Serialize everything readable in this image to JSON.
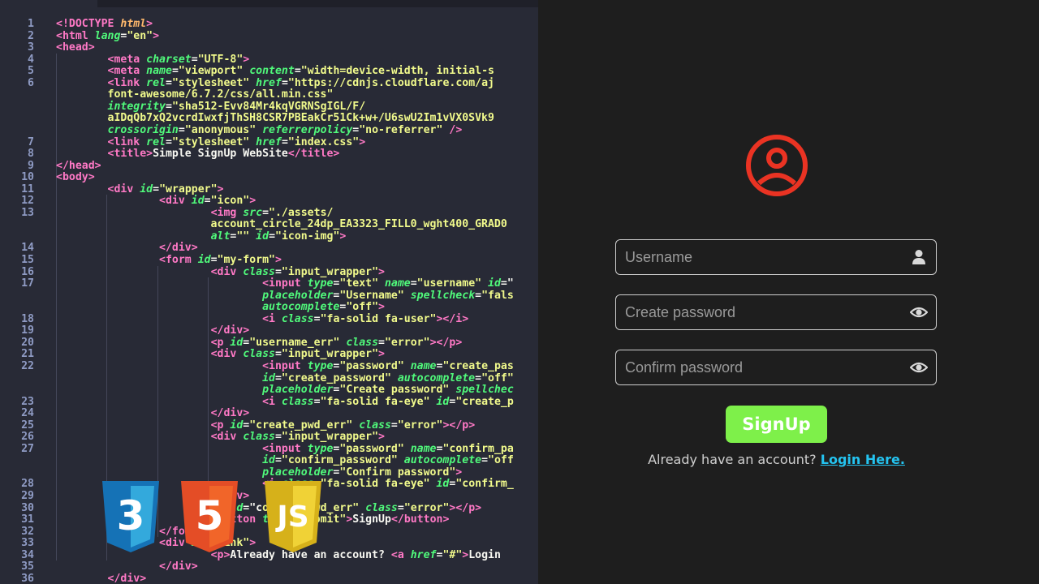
{
  "editor": {
    "line_numbers": [
      "1",
      "2",
      "3",
      "4",
      "5",
      "6",
      "7",
      "8",
      "9",
      "10",
      "11",
      "12",
      "13",
      "14",
      "15",
      "16",
      "17",
      "18",
      "19",
      "20",
      "21",
      "22",
      "23",
      "24",
      "25",
      "26",
      "27",
      "28",
      "29",
      "30",
      "31",
      "32",
      "33",
      "34",
      "35",
      "36"
    ],
    "lines": [
      [
        [
          "t",
          "<!DOCTYPE "
        ],
        [
          "d",
          "html"
        ],
        [
          "t",
          ">"
        ]
      ],
      [
        [
          "t",
          "<html "
        ],
        [
          "a",
          "lang"
        ],
        [
          "p",
          "="
        ],
        [
          "s",
          "\"en\""
        ],
        [
          "t",
          ">"
        ]
      ],
      [
        [
          "t",
          "<head>"
        ]
      ],
      [
        [
          "p",
          "        "
        ],
        [
          "t",
          "<meta "
        ],
        [
          "a",
          "charset"
        ],
        [
          "p",
          "="
        ],
        [
          "s",
          "\"UTF-8\""
        ],
        [
          "t",
          ">"
        ]
      ],
      [
        [
          "p",
          "        "
        ],
        [
          "t",
          "<meta "
        ],
        [
          "a",
          "name"
        ],
        [
          "p",
          "="
        ],
        [
          "s",
          "\"viewport\" "
        ],
        [
          "a",
          "content"
        ],
        [
          "p",
          "="
        ],
        [
          "s",
          "\"width=device-width, initial-s"
        ]
      ],
      [
        [
          "p",
          "        "
        ],
        [
          "t",
          "<link "
        ],
        [
          "a",
          "rel"
        ],
        [
          "p",
          "="
        ],
        [
          "s",
          "\"stylesheet\" "
        ],
        [
          "a",
          "href"
        ],
        [
          "p",
          "="
        ],
        [
          "s",
          "\"https://cdnjs.cloudflare.com/aj"
        ]
      ],
      [
        [
          "s",
          "        font-awesome/6.7.2/css/all.min.css\""
        ]
      ],
      [
        [
          "p",
          "        "
        ],
        [
          "a",
          "integrity"
        ],
        [
          "p",
          "="
        ],
        [
          "s",
          "\"sha512-Evv84Mr4kqVGRNSgIGL/F/"
        ]
      ],
      [
        [
          "s",
          "        aIDqQb7xQ2vcrdIwxfjThSH8CSR7PBEakCr51Ck+w+/U6swU2Im1vVX0SVk9"
        ]
      ],
      [
        [
          "p",
          "        "
        ],
        [
          "a",
          "crossorigin"
        ],
        [
          "p",
          "="
        ],
        [
          "s",
          "\"anonymous\" "
        ],
        [
          "a",
          "referrerpolicy"
        ],
        [
          "p",
          "="
        ],
        [
          "s",
          "\"no-referrer\""
        ],
        [
          "t",
          " />"
        ]
      ],
      [
        [
          "p",
          "        "
        ],
        [
          "t",
          "<link "
        ],
        [
          "a",
          "rel"
        ],
        [
          "p",
          "="
        ],
        [
          "s",
          "\"stylesheet\" "
        ],
        [
          "a",
          "href"
        ],
        [
          "p",
          "="
        ],
        [
          "s",
          "\"index.css\""
        ],
        [
          "t",
          ">"
        ]
      ],
      [
        [
          "p",
          "        "
        ],
        [
          "t",
          "<title>"
        ],
        [
          "p",
          "Simple SignUp WebSite"
        ],
        [
          "t",
          "</title>"
        ]
      ],
      [
        [
          "t",
          "</head>"
        ]
      ],
      [
        [
          "t",
          "<body>"
        ]
      ],
      [
        [
          "p",
          "        "
        ],
        [
          "t",
          "<div "
        ],
        [
          "a",
          "id"
        ],
        [
          "p",
          "="
        ],
        [
          "s",
          "\"wrapper\""
        ],
        [
          "t",
          ">"
        ]
      ],
      [
        [
          "p",
          "                "
        ],
        [
          "t",
          "<div "
        ],
        [
          "a",
          "id"
        ],
        [
          "p",
          "="
        ],
        [
          "s",
          "\"icon\""
        ],
        [
          "t",
          ">"
        ]
      ],
      [
        [
          "p",
          "                        "
        ],
        [
          "t",
          "<img "
        ],
        [
          "a",
          "src"
        ],
        [
          "p",
          "="
        ],
        [
          "s",
          "\"./assets/"
        ]
      ],
      [
        [
          "s",
          "                        account_circle_24dp_EA3323_FILL0_wght400_GRAD0"
        ]
      ],
      [
        [
          "p",
          "                        "
        ],
        [
          "a",
          "alt"
        ],
        [
          "p",
          "="
        ],
        [
          "s",
          "\"\" "
        ],
        [
          "a",
          "id"
        ],
        [
          "p",
          "="
        ],
        [
          "s",
          "\"icon-img\""
        ],
        [
          "t",
          ">"
        ]
      ],
      [
        [
          "p",
          "                "
        ],
        [
          "t",
          "</div>"
        ]
      ],
      [
        [
          "p",
          "                "
        ],
        [
          "t",
          "<form "
        ],
        [
          "a",
          "id"
        ],
        [
          "p",
          "="
        ],
        [
          "s",
          "\"my-form\""
        ],
        [
          "t",
          ">"
        ]
      ],
      [
        [
          "p",
          "                        "
        ],
        [
          "t",
          "<div "
        ],
        [
          "a",
          "class"
        ],
        [
          "p",
          "="
        ],
        [
          "s",
          "\"input_wrapper\""
        ],
        [
          "t",
          ">"
        ]
      ],
      [
        [
          "p",
          "                                "
        ],
        [
          "t",
          "<input "
        ],
        [
          "a",
          "type"
        ],
        [
          "p",
          "="
        ],
        [
          "s",
          "\"text\" "
        ],
        [
          "a",
          "name"
        ],
        [
          "p",
          "="
        ],
        [
          "s",
          "\"username\" "
        ],
        [
          "a",
          "id"
        ],
        [
          "p",
          "=\""
        ]
      ],
      [
        [
          "p",
          "                                "
        ],
        [
          "a",
          "placeholder"
        ],
        [
          "p",
          "="
        ],
        [
          "s",
          "\"Username\" "
        ],
        [
          "a",
          "spellcheck"
        ],
        [
          "p",
          "="
        ],
        [
          "s",
          "\"fals"
        ]
      ],
      [
        [
          "p",
          "                                "
        ],
        [
          "a",
          "autocomplete"
        ],
        [
          "p",
          "="
        ],
        [
          "s",
          "\"off\""
        ],
        [
          "t",
          ">"
        ]
      ],
      [
        [
          "p",
          "                                "
        ],
        [
          "t",
          "<i "
        ],
        [
          "a",
          "class"
        ],
        [
          "p",
          "="
        ],
        [
          "s",
          "\"fa-solid fa-user\""
        ],
        [
          "t",
          "></i>"
        ]
      ],
      [
        [
          "p",
          "                        "
        ],
        [
          "t",
          "</div>"
        ]
      ],
      [
        [
          "p",
          "                        "
        ],
        [
          "t",
          "<p "
        ],
        [
          "a",
          "id"
        ],
        [
          "p",
          "="
        ],
        [
          "s",
          "\"username_err\" "
        ],
        [
          "a",
          "class"
        ],
        [
          "p",
          "="
        ],
        [
          "s",
          "\"error\""
        ],
        [
          "t",
          "></p>"
        ]
      ],
      [
        [
          "p",
          "                        "
        ],
        [
          "t",
          "<div "
        ],
        [
          "a",
          "class"
        ],
        [
          "p",
          "="
        ],
        [
          "s",
          "\"input_wrapper\""
        ],
        [
          "t",
          ">"
        ]
      ],
      [
        [
          "p",
          "                                "
        ],
        [
          "t",
          "<input "
        ],
        [
          "a",
          "type"
        ],
        [
          "p",
          "="
        ],
        [
          "s",
          "\"password\" "
        ],
        [
          "a",
          "name"
        ],
        [
          "p",
          "="
        ],
        [
          "s",
          "\"create_pas"
        ]
      ],
      [
        [
          "p",
          "                                "
        ],
        [
          "a",
          "id"
        ],
        [
          "p",
          "="
        ],
        [
          "s",
          "\"create_password\" "
        ],
        [
          "a",
          "autocomplete"
        ],
        [
          "p",
          "="
        ],
        [
          "s",
          "\"off\""
        ]
      ],
      [
        [
          "p",
          "                                "
        ],
        [
          "a",
          "placeholder"
        ],
        [
          "p",
          "="
        ],
        [
          "s",
          "\"Create password\" "
        ],
        [
          "a",
          "spellchec"
        ]
      ],
      [
        [
          "p",
          "                                "
        ],
        [
          "t",
          "<i "
        ],
        [
          "a",
          "class"
        ],
        [
          "p",
          "="
        ],
        [
          "s",
          "\"fa-solid fa-eye\" "
        ],
        [
          "a",
          "id"
        ],
        [
          "p",
          "="
        ],
        [
          "s",
          "\"create_p"
        ]
      ],
      [
        [
          "p",
          "                        "
        ],
        [
          "t",
          "</div>"
        ]
      ],
      [
        [
          "p",
          "                        "
        ],
        [
          "t",
          "<p "
        ],
        [
          "a",
          "id"
        ],
        [
          "p",
          "="
        ],
        [
          "s",
          "\"create_pwd_err\" "
        ],
        [
          "a",
          "class"
        ],
        [
          "p",
          "="
        ],
        [
          "s",
          "\"error\""
        ],
        [
          "t",
          "></p>"
        ]
      ],
      [
        [
          "p",
          "                        "
        ],
        [
          "t",
          "<div "
        ],
        [
          "a",
          "class"
        ],
        [
          "p",
          "="
        ],
        [
          "s",
          "\"input_wrapper\""
        ],
        [
          "t",
          ">"
        ]
      ],
      [
        [
          "p",
          "                                "
        ],
        [
          "t",
          "<input "
        ],
        [
          "a",
          "type"
        ],
        [
          "p",
          "="
        ],
        [
          "s",
          "\"password\" "
        ],
        [
          "a",
          "name"
        ],
        [
          "p",
          "="
        ],
        [
          "s",
          "\"confirm_pa"
        ]
      ],
      [
        [
          "p",
          "                                "
        ],
        [
          "a",
          "id"
        ],
        [
          "p",
          "="
        ],
        [
          "s",
          "\"confirm_password\" "
        ],
        [
          "a",
          "autocomplete"
        ],
        [
          "p",
          "="
        ],
        [
          "s",
          "\"off"
        ]
      ],
      [
        [
          "p",
          "                                "
        ],
        [
          "a",
          "placeholder"
        ],
        [
          "p",
          "="
        ],
        [
          "s",
          "\"Confirm password\""
        ],
        [
          "t",
          ">"
        ]
      ],
      [
        [
          "p",
          "                                "
        ],
        [
          "t",
          "<i "
        ],
        [
          "a",
          "class"
        ],
        [
          "p",
          "="
        ],
        [
          "s",
          "\"fa-solid fa-eye\" "
        ],
        [
          "a",
          "id"
        ],
        [
          "p",
          "="
        ],
        [
          "s",
          "\"confirm_"
        ]
      ],
      [
        [
          "p",
          "                        "
        ],
        [
          "t",
          "</div>"
        ]
      ],
      [
        [
          "p",
          "                        "
        ],
        [
          "t",
          "<p "
        ],
        [
          "a",
          "id"
        ],
        [
          "p",
          "=\"c"
        ],
        [
          "s",
          "onfirm_pwd_err\" "
        ],
        [
          "a",
          "class"
        ],
        [
          "p",
          "="
        ],
        [
          "s",
          "\"error\""
        ],
        [
          "t",
          "></p>"
        ]
      ],
      [
        [
          "p",
          "                        "
        ],
        [
          "t",
          "<button "
        ],
        [
          "a",
          "type"
        ],
        [
          "p",
          "="
        ],
        [
          "s",
          "\"submit\""
        ],
        [
          "t",
          ">"
        ],
        [
          "p",
          "SignUp"
        ],
        [
          "t",
          "</button>"
        ]
      ],
      [
        [
          "p",
          "                "
        ],
        [
          "t",
          "</form>"
        ]
      ],
      [
        [
          "p",
          "                "
        ],
        [
          "t",
          "<div "
        ],
        [
          "a",
          "id"
        ],
        [
          "p",
          "="
        ],
        [
          "s",
          "\"link\""
        ],
        [
          "t",
          ">"
        ]
      ],
      [
        [
          "p",
          "                        "
        ],
        [
          "t",
          "<p>"
        ],
        [
          "p",
          "Already have an account? "
        ],
        [
          "t",
          "<a "
        ],
        [
          "a",
          "href"
        ],
        [
          "p",
          "="
        ],
        [
          "s",
          "\"#\""
        ],
        [
          "t",
          ">"
        ],
        [
          "p",
          "Login"
        ]
      ],
      [
        [
          "p",
          "                "
        ],
        [
          "t",
          "</div>"
        ]
      ],
      [
        [
          "p",
          "        "
        ],
        [
          "t",
          "</div>"
        ]
      ]
    ],
    "logos": {
      "css_label": "3",
      "html_label": "5",
      "js_label": "JS"
    }
  },
  "form": {
    "username_placeholder": "Username",
    "create_password_placeholder": "Create password",
    "confirm_password_placeholder": "Confirm password",
    "signup_label": "SignUp",
    "login_prompt": "Already have an account? ",
    "login_link": "Login Here."
  },
  "colors": {
    "accent_red": "#EA3323",
    "signup_green": "#7ef04a",
    "link_cyan": "#24c3f0"
  },
  "icons": {
    "avatar": "account-circle-icon",
    "username": "user-icon",
    "password": "eye-icon"
  }
}
